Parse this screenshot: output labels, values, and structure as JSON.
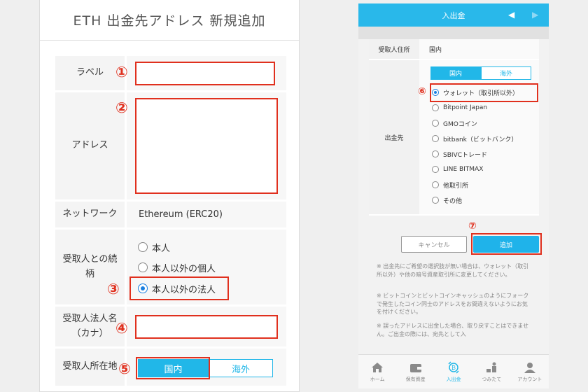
{
  "left": {
    "title": "ETH 出金先アドレス 新規追加",
    "fields": {
      "label": "ラベル",
      "address": "アドレス",
      "network_label": "ネットワーク",
      "network_value": "Ethereum (ERC20)",
      "relation_line1": "受取人との続",
      "relation_line2": "柄",
      "relation_options": [
        "本人",
        "本人以外の個人",
        "本人以外の法人"
      ],
      "corp_name_line1": "受取人法人名",
      "corp_name_line2": "（カナ）",
      "location_label": "受取人所在地",
      "location_domestic": "国内",
      "location_overseas": "海外"
    },
    "markers": [
      "①",
      "②",
      "③",
      "④",
      "⑤"
    ]
  },
  "right": {
    "header_title": "入出金",
    "prev_arrow": "◀",
    "next_arrow": "▶",
    "address_label": "受取人住所",
    "address_value": "国内",
    "tab_domestic": "国内",
    "tab_overseas": "海外",
    "destination_label": "出金先",
    "destinations": [
      "ウォレット（取引所以外）",
      "Bitpoint Japan",
      "GMOコイン",
      "bitbank（ビットバンク）",
      "SBIVCトレード",
      "LINE BITMAX",
      "他取引所",
      "その他"
    ],
    "markers": [
      "⑥",
      "⑦"
    ],
    "cancel_label": "キャンセル",
    "add_label": "追加",
    "notes": [
      "※ 出金先にご希望の選択肢が無い場合は、ウォレット（取引所以外）や他の暗号資産取引所に変更してください。",
      "※ ビットコインとビットコインキャッシュのようにフォークで発生したコイン同士のアドレスをお間違えないようにお気を付けください。",
      "※ 誤ったアドレスに出金した場合、取り戻すことはできません。ご出金の際には、宛先として入"
    ],
    "nav": [
      "ホーム",
      "保有資産",
      "入出金",
      "つみたて",
      "アカウント"
    ]
  },
  "colors": {
    "accent": "#21b7e8",
    "marker_red": "#e0301e",
    "radio_blue": "#1a7fe0"
  }
}
